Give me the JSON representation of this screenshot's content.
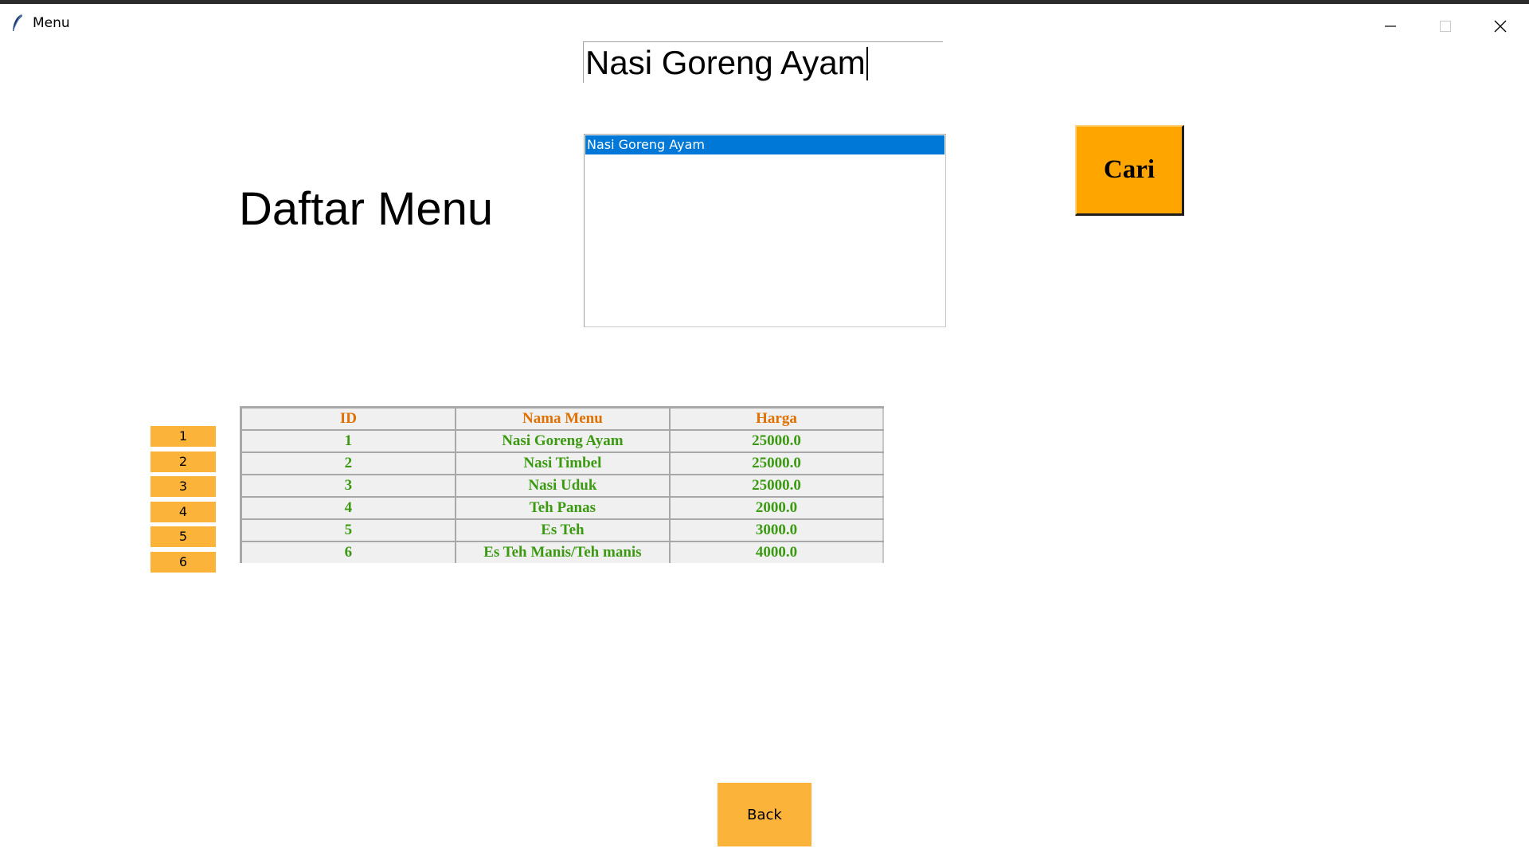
{
  "window": {
    "title": "Menu",
    "icon": "feather-icon"
  },
  "search": {
    "value": "Nasi Goreng Ayam",
    "button_label": "Cari"
  },
  "page_title": "Daftar Menu",
  "results": {
    "items": [
      "Nasi Goreng Ayam"
    ],
    "selected_index": 0
  },
  "row_buttons": [
    "1",
    "2",
    "3",
    "4",
    "5",
    "6"
  ],
  "table": {
    "columns": [
      "ID",
      "Nama Menu",
      "Harga"
    ],
    "rows": [
      [
        "1",
        "Nasi Goreng Ayam",
        "25000.0"
      ],
      [
        "2",
        "Nasi Timbel",
        "25000.0"
      ],
      [
        "3",
        "Nasi Uduk",
        "25000.0"
      ],
      [
        "4",
        "Teh Panas",
        "2000.0"
      ],
      [
        "5",
        "Es Teh",
        "3000.0"
      ],
      [
        "6",
        "Es Teh Manis/Teh manis",
        "4000.0"
      ]
    ]
  },
  "back_button_label": "Back",
  "colors": {
    "accent_orange": "#ffa500",
    "button_orange": "#fbb33a",
    "header_text": "#e07000",
    "cell_text": "#3c9a12",
    "selection_blue": "#0078d7"
  }
}
